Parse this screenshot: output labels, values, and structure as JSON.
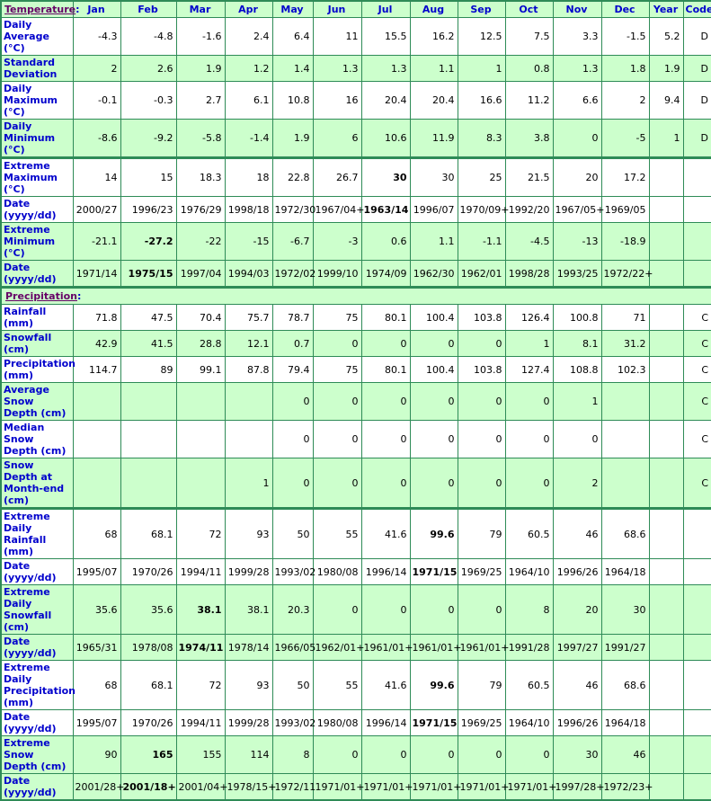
{
  "colors": {
    "header_bg": "#ccffcc",
    "border": "#2e8b57",
    "label": "#0000cc",
    "link": "#660066"
  },
  "header": {
    "section_label": "Temperature",
    "columns": [
      "Jan",
      "Feb",
      "Mar",
      "Apr",
      "May",
      "Jun",
      "Jul",
      "Aug",
      "Sep",
      "Oct",
      "Nov",
      "Dec",
      "Year",
      "Code"
    ]
  },
  "temperature_rows": [
    {
      "label": "Daily Average (°C)",
      "shade": false,
      "values": [
        "-4.3",
        "-4.8",
        "-1.6",
        "2.4",
        "6.4",
        "11",
        "15.5",
        "16.2",
        "12.5",
        "7.5",
        "3.3",
        "-1.5",
        "5.2"
      ],
      "code": "D",
      "bold": []
    },
    {
      "label": "Standard Deviation",
      "shade": true,
      "values": [
        "2",
        "2.6",
        "1.9",
        "1.2",
        "1.4",
        "1.3",
        "1.3",
        "1.1",
        "1",
        "0.8",
        "1.3",
        "1.8",
        "1.9"
      ],
      "code": "D",
      "bold": []
    },
    {
      "label": "Daily Maximum (°C)",
      "shade": false,
      "values": [
        "-0.1",
        "-0.3",
        "2.7",
        "6.1",
        "10.8",
        "16",
        "20.4",
        "20.4",
        "16.6",
        "11.2",
        "6.6",
        "2",
        "9.4"
      ],
      "code": "D",
      "bold": []
    },
    {
      "label": "Daily Minimum (°C)",
      "shade": true,
      "values": [
        "-8.6",
        "-9.2",
        "-5.8",
        "-1.4",
        "1.9",
        "6",
        "10.6",
        "11.9",
        "8.3",
        "3.8",
        "0",
        "-5",
        "1"
      ],
      "code": "D",
      "bold": []
    },
    {
      "label": "Extreme Maximum (°C)",
      "shade": false,
      "section_break": true,
      "values": [
        "14",
        "15",
        "18.3",
        "18",
        "22.8",
        "26.7",
        "30",
        "30",
        "25",
        "21.5",
        "20",
        "17.2",
        ""
      ],
      "code": "",
      "bold": [
        6
      ]
    },
    {
      "label": "Date (yyyy/dd)",
      "shade": false,
      "values": [
        "2000/27",
        "1996/23",
        "1976/29",
        "1998/18",
        "1972/30",
        "1967/04+",
        "1963/14",
        "1996/07",
        "1970/09+",
        "1992/20",
        "1967/05+",
        "1969/05",
        ""
      ],
      "code": "",
      "bold": [
        6
      ]
    },
    {
      "label": "Extreme Minimum (°C)",
      "shade": true,
      "values": [
        "-21.1",
        "-27.2",
        "-22",
        "-15",
        "-6.7",
        "-3",
        "0.6",
        "1.1",
        "-1.1",
        "-4.5",
        "-13",
        "-18.9",
        ""
      ],
      "code": "",
      "bold": [
        1
      ]
    },
    {
      "label": "Date (yyyy/dd)",
      "shade": true,
      "values": [
        "1971/14",
        "1975/15",
        "1997/04",
        "1994/03",
        "1972/02",
        "1999/10",
        "1974/09",
        "1962/30",
        "1962/01",
        "1998/28",
        "1993/25",
        "1972/22+",
        ""
      ],
      "code": "",
      "bold": [
        1
      ]
    }
  ],
  "precipitation": {
    "section_label": "Precipitation",
    "rows": [
      {
        "label": "Rainfall (mm)",
        "shade": false,
        "values": [
          "71.8",
          "47.5",
          "70.4",
          "75.7",
          "78.7",
          "75",
          "80.1",
          "100.4",
          "103.8",
          "126.4",
          "100.8",
          "71",
          ""
        ],
        "code": "C",
        "bold": []
      },
      {
        "label": "Snowfall (cm)",
        "shade": true,
        "values": [
          "42.9",
          "41.5",
          "28.8",
          "12.1",
          "0.7",
          "0",
          "0",
          "0",
          "0",
          "1",
          "8.1",
          "31.2",
          ""
        ],
        "code": "C",
        "bold": []
      },
      {
        "label": "Precipitation (mm)",
        "shade": false,
        "values": [
          "114.7",
          "89",
          "99.1",
          "87.8",
          "79.4",
          "75",
          "80.1",
          "100.4",
          "103.8",
          "127.4",
          "108.8",
          "102.3",
          ""
        ],
        "code": "C",
        "bold": []
      },
      {
        "label": "Average Snow Depth (cm)",
        "shade": true,
        "values": [
          "",
          "",
          "",
          "",
          "0",
          "0",
          "0",
          "0",
          "0",
          "0",
          "1",
          "",
          ""
        ],
        "code": "C",
        "bold": []
      },
      {
        "label": "Median Snow Depth (cm)",
        "shade": false,
        "values": [
          "",
          "",
          "",
          "",
          "0",
          "0",
          "0",
          "0",
          "0",
          "0",
          "0",
          "",
          ""
        ],
        "code": "C",
        "bold": []
      },
      {
        "label": "Snow Depth at Month-end (cm)",
        "shade": true,
        "values": [
          "",
          "",
          "",
          "1",
          "0",
          "0",
          "0",
          "0",
          "0",
          "0",
          "2",
          "",
          ""
        ],
        "code": "C",
        "bold": []
      },
      {
        "label": "Extreme Daily Rainfall (mm)",
        "shade": false,
        "section_break": true,
        "values": [
          "68",
          "68.1",
          "72",
          "93",
          "50",
          "55",
          "41.6",
          "99.6",
          "79",
          "60.5",
          "46",
          "68.6",
          ""
        ],
        "code": "",
        "bold": [
          7
        ]
      },
      {
        "label": "Date (yyyy/dd)",
        "shade": false,
        "values": [
          "1995/07",
          "1970/26",
          "1994/11",
          "1999/28",
          "1993/02",
          "1980/08",
          "1996/14",
          "1971/15",
          "1969/25",
          "1964/10",
          "1996/26",
          "1964/18",
          ""
        ],
        "code": "",
        "bold": [
          7
        ]
      },
      {
        "label": "Extreme Daily Snowfall (cm)",
        "shade": true,
        "values": [
          "35.6",
          "35.6",
          "38.1",
          "38.1",
          "20.3",
          "0",
          "0",
          "0",
          "0",
          "8",
          "20",
          "30",
          ""
        ],
        "code": "",
        "bold": [
          2
        ]
      },
      {
        "label": "Date (yyyy/dd)",
        "shade": true,
        "values": [
          "1965/31",
          "1978/08",
          "1974/11",
          "1978/14",
          "1966/05",
          "1962/01+",
          "1961/01+",
          "1961/01+",
          "1961/01+",
          "1991/28",
          "1997/27",
          "1991/27",
          ""
        ],
        "code": "",
        "bold": [
          2
        ]
      },
      {
        "label": "Extreme Daily Precipitation (mm)",
        "shade": false,
        "values": [
          "68",
          "68.1",
          "72",
          "93",
          "50",
          "55",
          "41.6",
          "99.6",
          "79",
          "60.5",
          "46",
          "68.6",
          ""
        ],
        "code": "",
        "bold": [
          7
        ]
      },
      {
        "label": "Date (yyyy/dd)",
        "shade": false,
        "values": [
          "1995/07",
          "1970/26",
          "1994/11",
          "1999/28",
          "1993/02",
          "1980/08",
          "1996/14",
          "1971/15",
          "1969/25",
          "1964/10",
          "1996/26",
          "1964/18",
          ""
        ],
        "code": "",
        "bold": [
          7
        ]
      },
      {
        "label": "Extreme Snow Depth (cm)",
        "shade": true,
        "values": [
          "90",
          "165",
          "155",
          "114",
          "8",
          "0",
          "0",
          "0",
          "0",
          "0",
          "30",
          "46",
          ""
        ],
        "code": "",
        "bold": [
          1
        ]
      },
      {
        "label": "Date (yyyy/dd)",
        "shade": true,
        "values": [
          "2001/28+",
          "2001/18+",
          "2001/04+",
          "1978/15+",
          "1972/11",
          "1971/01+",
          "1971/01+",
          "1971/01+",
          "1971/01+",
          "1971/01+",
          "1997/28+",
          "1972/23+",
          ""
        ],
        "code": "",
        "bold": [
          1
        ]
      }
    ]
  }
}
